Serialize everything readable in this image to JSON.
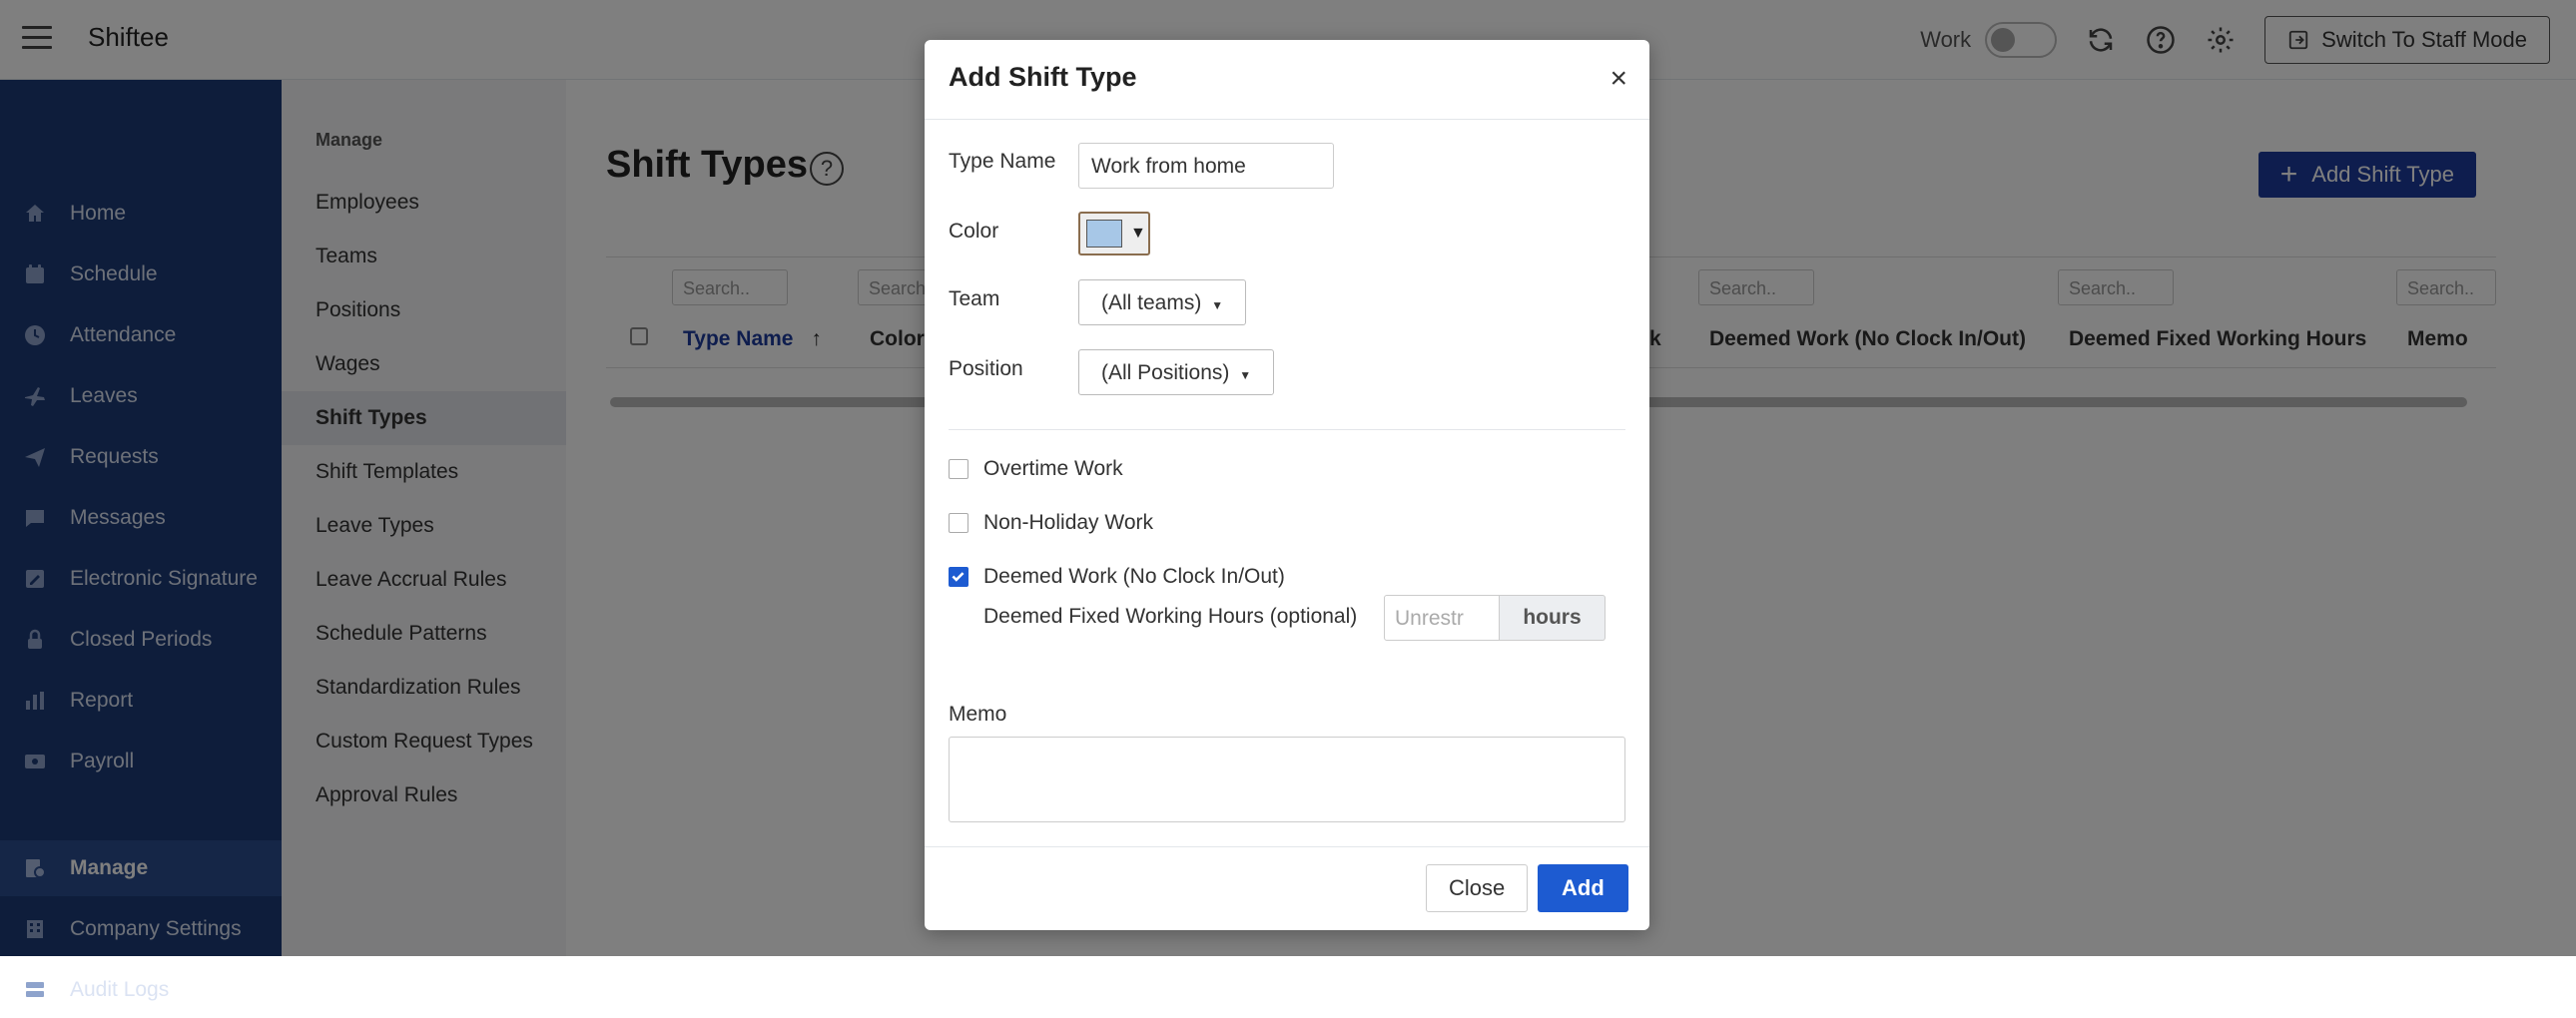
{
  "app": {
    "brand": "Shiftee"
  },
  "topbar": {
    "work_label": "Work",
    "staff_mode_label": "Switch To Staff Mode"
  },
  "sidebar": {
    "items": [
      {
        "label": "Home",
        "icon": "home-icon"
      },
      {
        "label": "Schedule",
        "icon": "calendar-icon"
      },
      {
        "label": "Attendance",
        "icon": "clock-icon"
      },
      {
        "label": "Leaves",
        "icon": "plane-icon"
      },
      {
        "label": "Requests",
        "icon": "send-icon"
      },
      {
        "label": "Messages",
        "icon": "message-icon"
      },
      {
        "label": "Electronic Signature",
        "icon": "signature-icon"
      },
      {
        "label": "Closed Periods",
        "icon": "lock-icon"
      },
      {
        "label": "Report",
        "icon": "chart-icon"
      },
      {
        "label": "Payroll",
        "icon": "payroll-icon"
      },
      {
        "label": "Manage",
        "icon": "manage-icon"
      },
      {
        "label": "Company Settings",
        "icon": "building-icon"
      },
      {
        "label": "Audit Logs",
        "icon": "log-icon"
      }
    ]
  },
  "submenu": {
    "heading": "Manage",
    "items": [
      "Employees",
      "Teams",
      "Positions",
      "Wages",
      "Shift Types",
      "Shift Templates",
      "Leave Types",
      "Leave Accrual Rules",
      "Schedule Patterns",
      "Standardization Rules",
      "Custom Request Types",
      "Approval Rules"
    ]
  },
  "main": {
    "title": "Shift Types",
    "add_button": "Add Shift Type",
    "search_placeholder": "Search..",
    "columns": [
      "Type Name",
      "Color",
      "k",
      "Deemed Work (No Clock In/Out)",
      "Deemed Fixed Working Hours",
      "Memo"
    ],
    "search_partial": "Search"
  },
  "modal": {
    "title": "Add Shift Type",
    "close_glyph": "×",
    "type_name_label": "Type Name",
    "type_name_value": "Work from home",
    "color_label": "Color",
    "color_value": "#a7c7e7",
    "team_label": "Team",
    "team_value": "(All teams)",
    "position_label": "Position",
    "position_value": "(All Positions)",
    "overtime_label": "Overtime Work",
    "nonholiday_label": "Non-Holiday Work",
    "deemed_label": "Deemed Work (No Clock In/Out)",
    "deemed_hours_label": "Deemed Fixed Working Hours (optional)",
    "hours_placeholder": "Unrestr",
    "hours_suffix": "hours",
    "memo_label": "Memo",
    "close_button": "Close",
    "add_button": "Add"
  },
  "colors": {
    "sidebar_bg": "#1d3a77",
    "primary": "#1d5bd1",
    "accent_dark": "#1d3a9c"
  }
}
